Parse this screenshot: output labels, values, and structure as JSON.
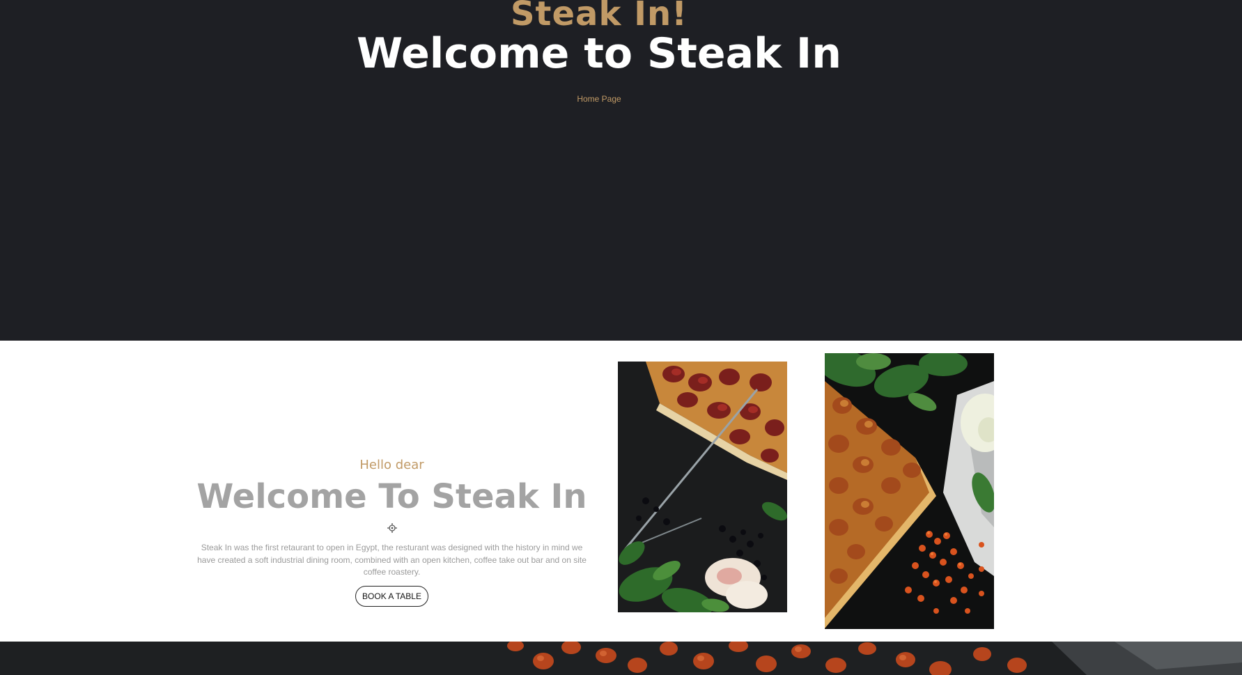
{
  "hero": {
    "brand": "Steak In!",
    "title": "Welcome to Steak In",
    "nav_link": "Home Page"
  },
  "about": {
    "greeting": "Hello dear",
    "title": "Welcome To Steak In",
    "description": "Steak In was the first retaurant to open in Egypt, the resturant was designed with the history in mind we have created a soft industrial dining room, combined with an open kitchen, coffee take out bar and on site coffee roastery.",
    "button_label": "BOOK A TABLE",
    "divider_icon": "ornament-icon"
  },
  "colors": {
    "hero_background": "#1e1f24",
    "accent": "#c19a66",
    "about_background": "#ffffff",
    "title_gray": "#a3a3a3"
  }
}
